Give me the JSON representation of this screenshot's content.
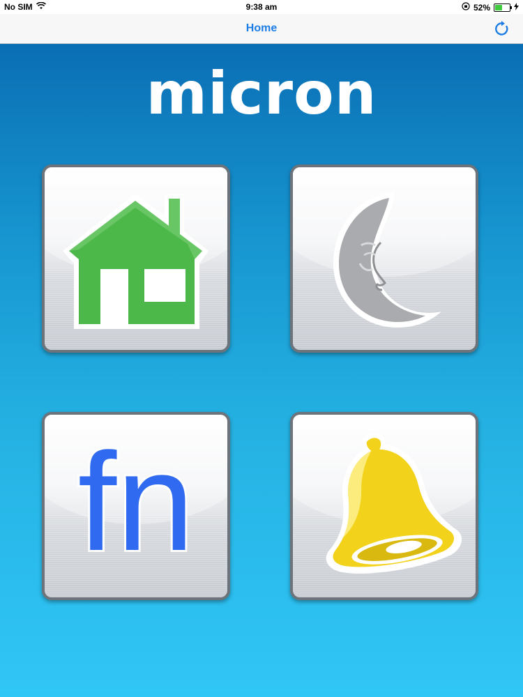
{
  "status_bar": {
    "carrier": "No SIM",
    "time": "9:38 am",
    "battery_percent": "52%",
    "battery_level": 0.52,
    "icons": [
      "wifi-icon",
      "orientation-lock-icon",
      "battery-icon",
      "charging-icon"
    ]
  },
  "nav": {
    "title": "Home",
    "refresh_icon": "refresh-icon"
  },
  "logo": {
    "text": "micron"
  },
  "tiles": [
    {
      "icon": "house-icon",
      "color": "#4db84a"
    },
    {
      "icon": "moon-icon",
      "color": "#a9abae"
    },
    {
      "label": "fn",
      "color": "#2f6af0"
    },
    {
      "icon": "bell-icon",
      "color": "#f2d21a"
    }
  ],
  "colors": {
    "accent": "#1d7de6",
    "background_top": "#0a6eb4",
    "background_bottom": "#30c6f6"
  }
}
